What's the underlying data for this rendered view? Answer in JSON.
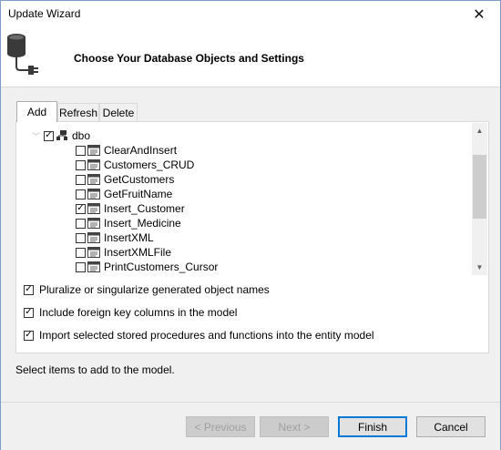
{
  "window": {
    "title": "Update Wizard",
    "close_symbol": "✕"
  },
  "header": {
    "title": "Choose Your Database Objects and Settings",
    "icon": "database-plug-icon"
  },
  "tabs": [
    {
      "label": "Add",
      "active": true
    },
    {
      "label": "Refresh",
      "active": false
    },
    {
      "label": "Delete",
      "active": false
    }
  ],
  "tree": {
    "root": {
      "label": "dbo",
      "checked": true
    },
    "items": [
      {
        "label": "ClearAndInsert",
        "checked": false
      },
      {
        "label": "Customers_CRUD",
        "checked": false
      },
      {
        "label": "GetCustomers",
        "checked": false
      },
      {
        "label": "GetFruitName",
        "checked": false
      },
      {
        "label": "Insert_Customer",
        "checked": true
      },
      {
        "label": "Insert_Medicine",
        "checked": false
      },
      {
        "label": "InsertXML",
        "checked": false
      },
      {
        "label": "InsertXMLFile",
        "checked": false
      },
      {
        "label": "PrintCustomers_Cursor",
        "checked": false
      }
    ]
  },
  "options": [
    {
      "label": "Pluralize or singularize generated object names",
      "checked": true
    },
    {
      "label": "Include foreign key columns in the model",
      "checked": true
    },
    {
      "label": "Import selected stored procedures and functions into the entity model",
      "checked": true
    }
  ],
  "status": "Select items to add to the model.",
  "buttons": {
    "previous": {
      "label": "< Previous",
      "enabled": false
    },
    "next": {
      "label": "Next >",
      "enabled": false
    },
    "finish": {
      "label": "Finish",
      "enabled": true
    },
    "cancel": {
      "label": "Cancel",
      "enabled": true
    }
  },
  "colors": {
    "accent": "#0078d7",
    "panel": "#f0f0f0"
  }
}
